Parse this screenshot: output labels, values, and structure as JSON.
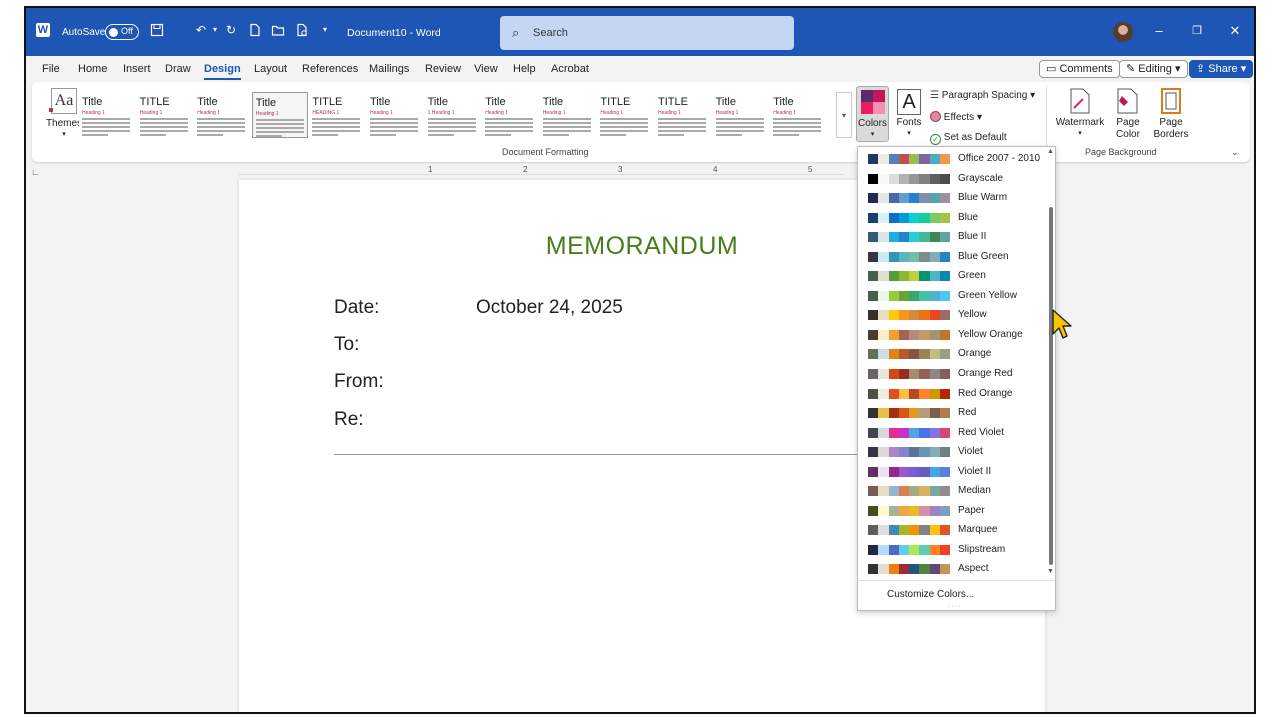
{
  "titlebar": {
    "autosave_label": "AutoSave",
    "autosave_state": "Off",
    "document_title": "Document10  -  Word",
    "search_placeholder": "Search"
  },
  "menu": {
    "tabs": [
      "File",
      "Home",
      "Insert",
      "Draw",
      "Design",
      "Layout",
      "References",
      "Mailings",
      "Review",
      "View",
      "Help",
      "Acrobat"
    ],
    "active": "Design",
    "comments": "Comments",
    "editing": "Editing",
    "share": "Share"
  },
  "ribbon": {
    "themes": "Themes",
    "colors": "Colors",
    "fonts": "Fonts",
    "paragraph_spacing": "Paragraph Spacing",
    "effects": "Effects",
    "set_as_default": "Set as Default",
    "document_formatting": "Document Formatting",
    "watermark": "Watermark",
    "page_color": "Page Color",
    "page_borders": "Page Borders",
    "page_background": "Page Background",
    "style_thumbs": [
      {
        "title": "Title",
        "heading": "Heading 1"
      },
      {
        "title": "TITLE",
        "heading": "Heading 1"
      },
      {
        "title": "Title",
        "heading": "Heading 1"
      },
      {
        "title": "Title",
        "heading": "Heading 1"
      },
      {
        "title": "TITLE",
        "heading": "HEADING 1"
      },
      {
        "title": "Title",
        "heading": "Heading 1"
      },
      {
        "title": "Title",
        "heading": "1 Heading 1"
      },
      {
        "title": "Title",
        "heading": "Heading 1"
      },
      {
        "title": "Title",
        "heading": "Heading 1"
      },
      {
        "title": "TITLE",
        "heading": "Heading 1"
      },
      {
        "title": "TITLE",
        "heading": "Heading 1"
      },
      {
        "title": "Title",
        "heading": "Heading 1"
      },
      {
        "title": "Title",
        "heading": "Heading 1"
      }
    ]
  },
  "ruler": {
    "numbers": [
      "1",
      "2",
      "3",
      "4",
      "5"
    ]
  },
  "document": {
    "memo_title": "MEMORANDUM",
    "date_label": "Date:",
    "date_value": "October 24, 2025",
    "to_label": "To:",
    "from_label": "From:",
    "re_label": "Re:"
  },
  "colors_dropdown": {
    "customize": "Customize Colors...",
    "schemes": [
      {
        "name": "Office 2007 - 2010",
        "swatches": [
          "#1f3864",
          "#eeece1",
          "#4f81bd",
          "#c0504d",
          "#9bbb59",
          "#8064a2",
          "#4bacc6",
          "#f79646"
        ]
      },
      {
        "name": "Grayscale",
        "swatches": [
          "#000000",
          "#f8f8f8",
          "#dddddd",
          "#b2b2b2",
          "#969696",
          "#808080",
          "#5f5f5f",
          "#4d4d4d"
        ]
      },
      {
        "name": "Blue Warm",
        "swatches": [
          "#242852",
          "#e7e6e6",
          "#4a66ac",
          "#629dd1",
          "#297fd5",
          "#7f8fa9",
          "#5aa2ae",
          "#9d90a0"
        ]
      },
      {
        "name": "Blue",
        "swatches": [
          "#17406d",
          "#dbeff9",
          "#0f6fc6",
          "#009dd9",
          "#0bd0d9",
          "#10cf9b",
          "#7cca62",
          "#a5c249"
        ]
      },
      {
        "name": "Blue II",
        "swatches": [
          "#335b74",
          "#dfe3e5",
          "#1cade4",
          "#2683c6",
          "#27ced7",
          "#42ba97",
          "#3e8853",
          "#62a39f"
        ]
      },
      {
        "name": "Blue Green",
        "swatches": [
          "#373545",
          "#ceeaf1",
          "#3494ba",
          "#58b6c0",
          "#75bda7",
          "#7a8c8e",
          "#84acb6",
          "#2683c6"
        ]
      },
      {
        "name": "Green",
        "swatches": [
          "#455f51",
          "#e3ded1",
          "#549e39",
          "#8ab833",
          "#c0cf3a",
          "#029676",
          "#4ab5c4",
          "#0989b1"
        ]
      },
      {
        "name": "Green Yellow",
        "swatches": [
          "#455f51",
          "#ebf8e5",
          "#99cb38",
          "#63a537",
          "#37a76f",
          "#44c1a3",
          "#4eb3cf",
          "#51c3f9"
        ]
      },
      {
        "name": "Yellow",
        "swatches": [
          "#39302a",
          "#e5dec0",
          "#ffca08",
          "#f8931d",
          "#ce8d3e",
          "#ec7016",
          "#e64823",
          "#9c6a6a"
        ]
      },
      {
        "name": "Yellow Orange",
        "swatches": [
          "#4e3b30",
          "#fbeec9",
          "#f0a22e",
          "#a5644e",
          "#b58b80",
          "#c3986d",
          "#a19574",
          "#c17529"
        ]
      },
      {
        "name": "Orange",
        "swatches": [
          "#637052",
          "#ccddea",
          "#e48312",
          "#bd582c",
          "#865640",
          "#9b8357",
          "#c2bc80",
          "#94a088"
        ]
      },
      {
        "name": "Orange Red",
        "swatches": [
          "#696464",
          "#e9e5dc",
          "#d34817",
          "#9b2d1f",
          "#a28e6a",
          "#956251",
          "#918485",
          "#855d5d"
        ]
      },
      {
        "name": "Red Orange",
        "swatches": [
          "#505046",
          "#eeece1",
          "#e84c22",
          "#ffbd47",
          "#b64926",
          "#ff8427",
          "#cc9900",
          "#b22600"
        ]
      },
      {
        "name": "Red",
        "swatches": [
          "#323232",
          "#e5c243",
          "#a5300f",
          "#d55816",
          "#e19825",
          "#b19c7d",
          "#7f5f52",
          "#b27d49"
        ]
      },
      {
        "name": "Red Violet",
        "swatches": [
          "#454551",
          "#d8d9dc",
          "#e32d91",
          "#c830cc",
          "#4ea6dc",
          "#4775e7",
          "#8971e1",
          "#d54773"
        ]
      },
      {
        "name": "Violet",
        "swatches": [
          "#373545",
          "#dcd8dc",
          "#ad84c6",
          "#8784c7",
          "#5d739a",
          "#6997af",
          "#84acb6",
          "#6f8183"
        ]
      },
      {
        "name": "Violet II",
        "swatches": [
          "#632e62",
          "#eae5eb",
          "#92278f",
          "#9b57d3",
          "#755dd9",
          "#665eb8",
          "#45a5ed",
          "#5982db"
        ]
      },
      {
        "name": "Median",
        "swatches": [
          "#775f55",
          "#ebddc3",
          "#94b6d2",
          "#dd8047",
          "#a5ab81",
          "#d8b25c",
          "#7ba79d",
          "#968c8c"
        ]
      },
      {
        "name": "Paper",
        "swatches": [
          "#444d26",
          "#fefac9",
          "#a5b592",
          "#f3a447",
          "#e7bc29",
          "#d092a7",
          "#9c85c0",
          "#809ec2"
        ]
      },
      {
        "name": "Marquee",
        "swatches": [
          "#5e5e5e",
          "#ddddde",
          "#418ab3",
          "#a6b727",
          "#f69200",
          "#838383",
          "#fec306",
          "#df5327"
        ]
      },
      {
        "name": "Slipstream",
        "swatches": [
          "#212745",
          "#b4dcfa",
          "#4e67c8",
          "#5eccf3",
          "#a7ea52",
          "#5dceaf",
          "#ff8021",
          "#f14124"
        ]
      },
      {
        "name": "Aspect",
        "swatches": [
          "#323232",
          "#e3ded1",
          "#f07f09",
          "#9f2936",
          "#1b587c",
          "#4e8542",
          "#604878",
          "#c19859"
        ]
      }
    ]
  }
}
